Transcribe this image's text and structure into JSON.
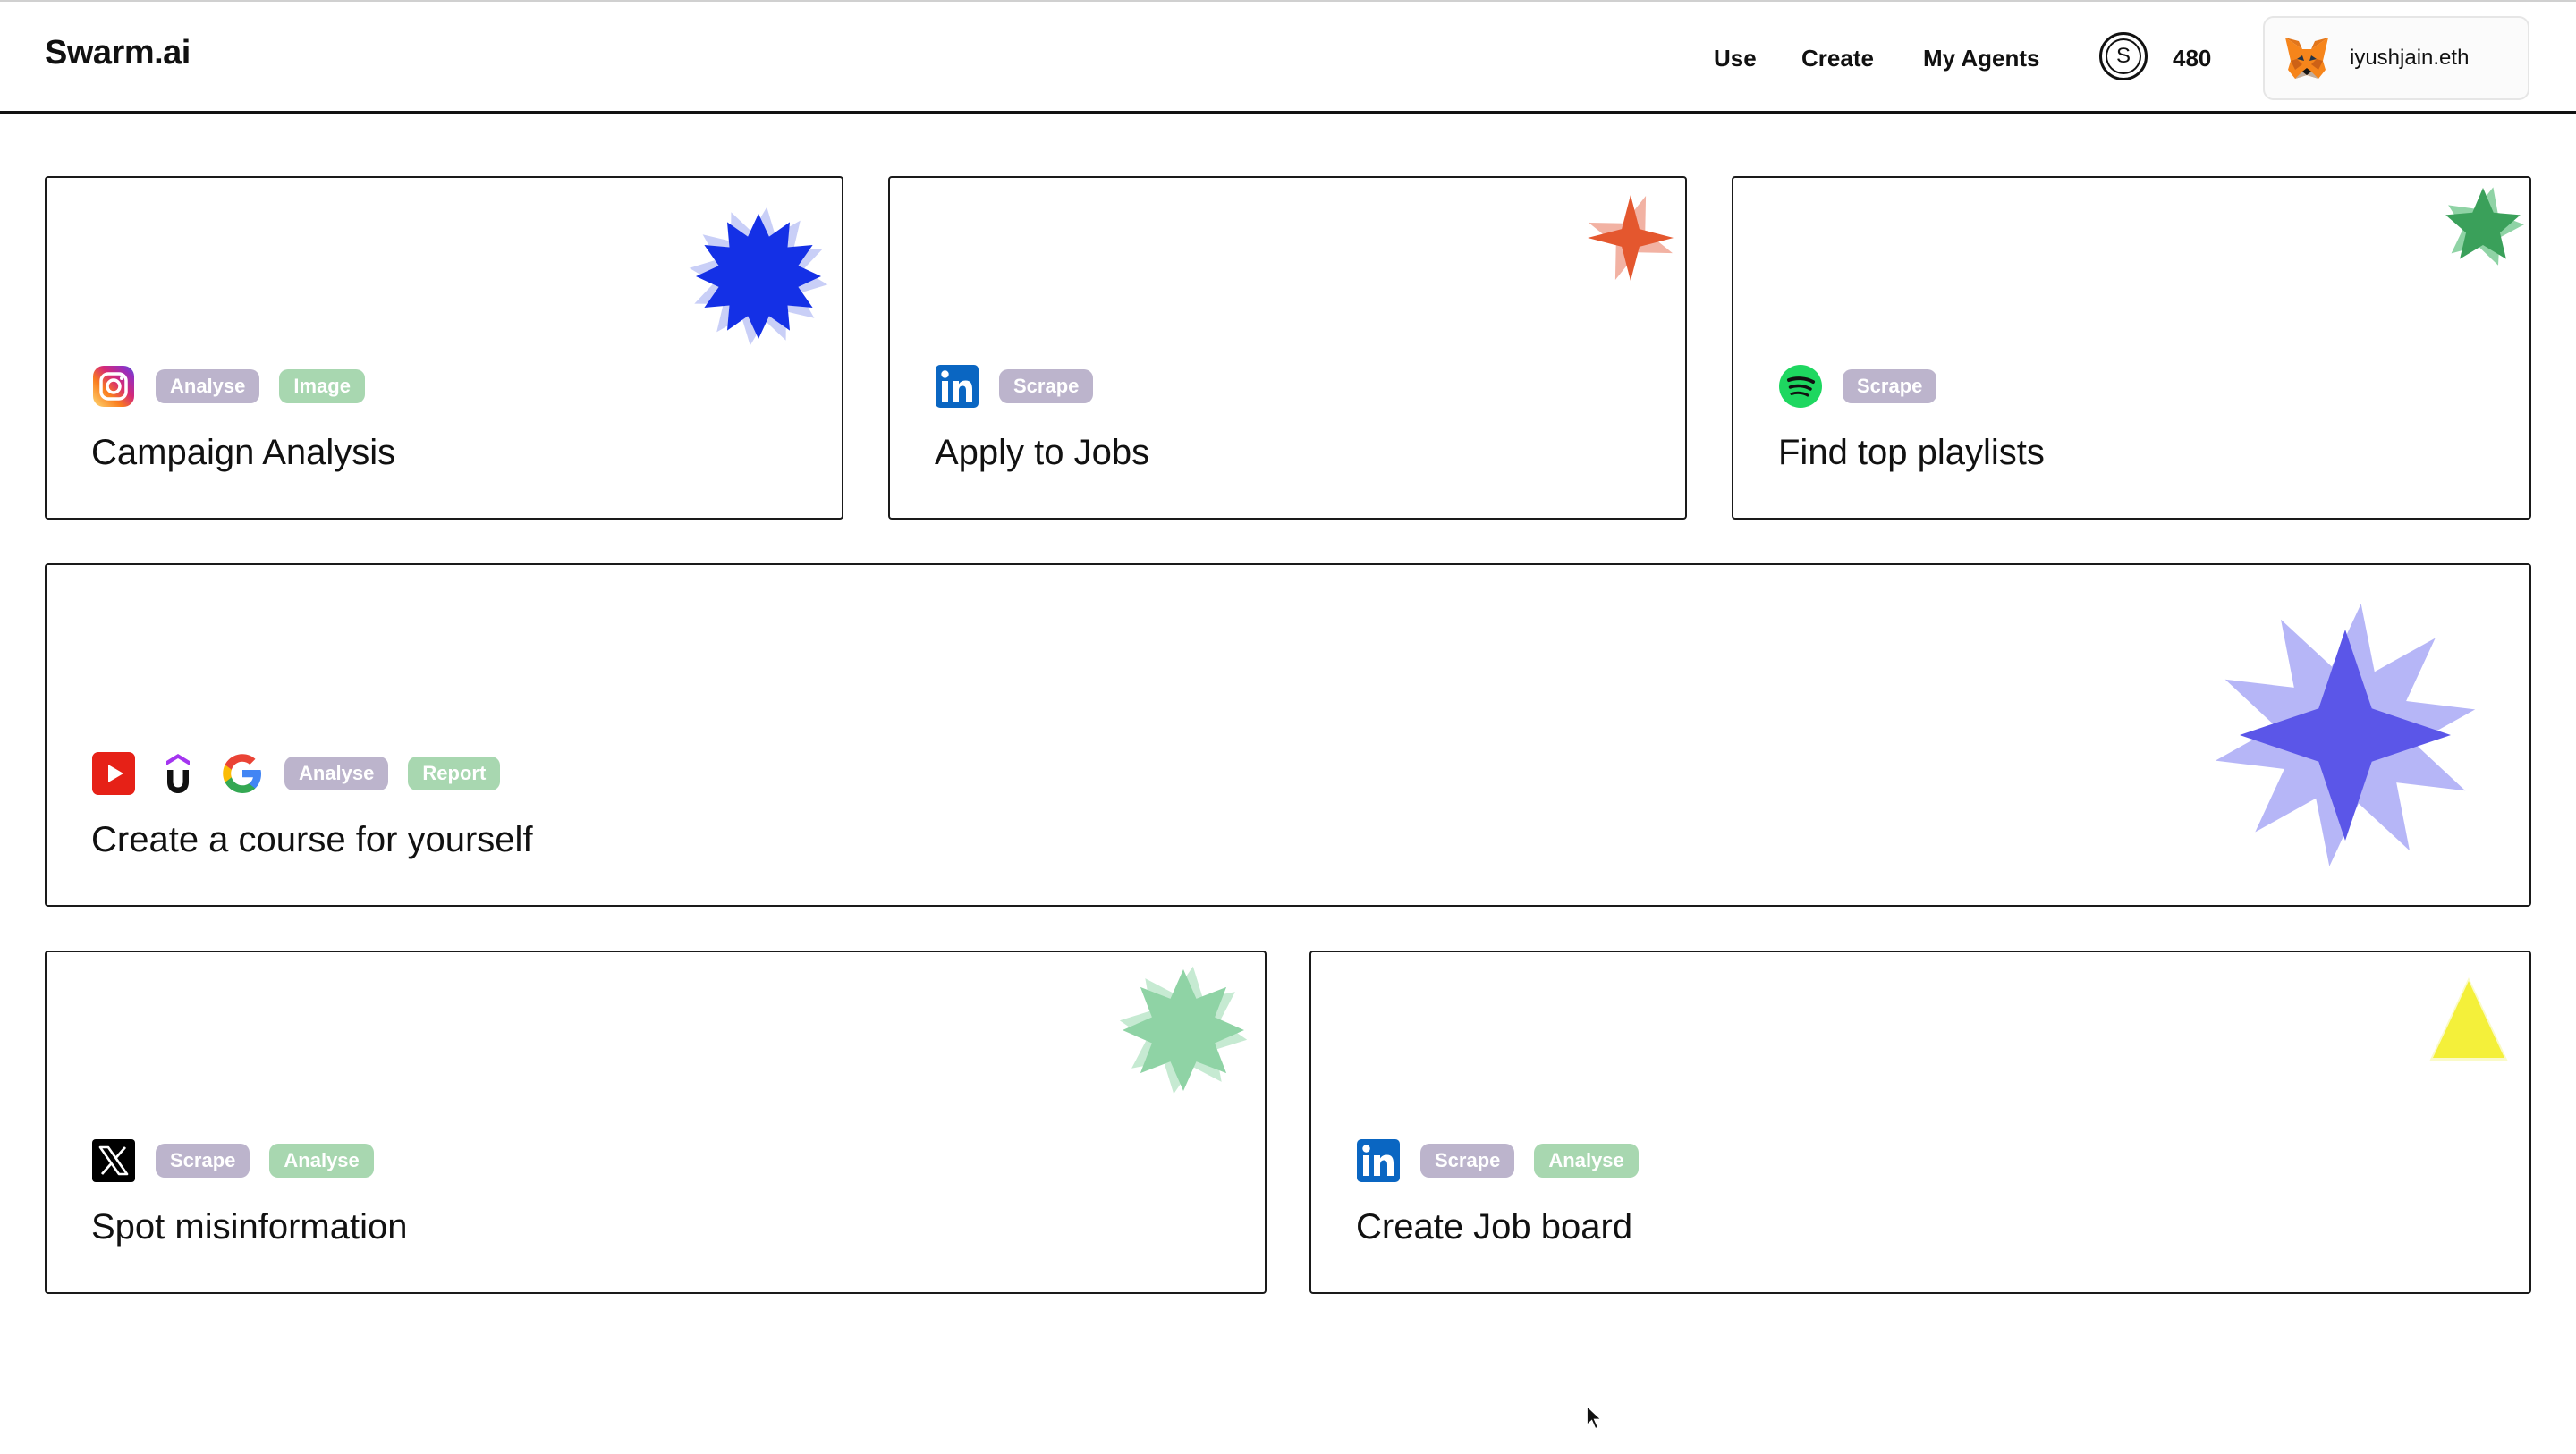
{
  "header": {
    "logo": "Swarm.ai",
    "nav": [
      "Use",
      "Create",
      "My Agents"
    ],
    "credits_symbol": "S",
    "credits": "480",
    "wallet_name": "iyushjain.eth"
  },
  "cards": [
    {
      "title": "Campaign Analysis",
      "apps": [
        "instagram-icon"
      ],
      "tags": [
        "Analyse",
        "Image"
      ],
      "accent": "#1430e6"
    },
    {
      "title": "Apply to Jobs",
      "apps": [
        "linkedin-icon"
      ],
      "tags": [
        "Scrape"
      ],
      "accent": "#e4572e"
    },
    {
      "title": "Find top playlists",
      "apps": [
        "spotify-icon"
      ],
      "tags": [
        "Scrape"
      ],
      "accent": "#3aa05a"
    },
    {
      "title": "Create a course for yourself",
      "apps": [
        "youtube-icon",
        "udemy-icon",
        "google-icon"
      ],
      "tags": [
        "Analyse",
        "Report"
      ],
      "accent": "#5b56e8"
    },
    {
      "title": "Spot misinformation",
      "apps": [
        "x-icon"
      ],
      "tags": [
        "Scrape",
        "Analyse"
      ],
      "accent": "#8fd3a5"
    },
    {
      "title": "Create Job board",
      "apps": [
        "linkedin-icon"
      ],
      "tags": [
        "Scrape",
        "Analyse"
      ],
      "accent": "#f4f03a"
    }
  ],
  "colors": {
    "tag_purple": "#bcb4cc",
    "tag_green": "#a8d7b0",
    "border": "#1a1a1a"
  }
}
